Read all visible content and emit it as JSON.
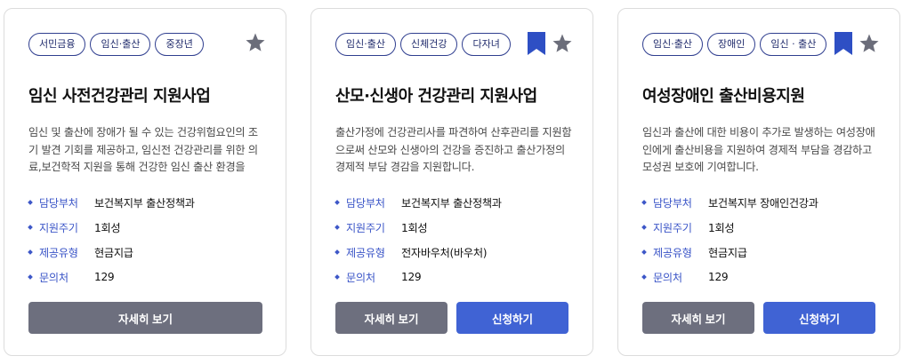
{
  "cards": [
    {
      "tags": [
        "서민금융",
        "임신·출산",
        "중장년"
      ],
      "bookmarked": false,
      "title": "임신 사전건강관리 지원사업",
      "description": "임신 및 출산에 장애가 될 수 있는 건강위험요인의 조기 발견 기회를 제공하고, 임신전 건강관리를 위한 의료,보건학적 지원을 통해 건강한 임신 출산 환경을",
      "info": [
        {
          "label": "담당부처",
          "value": "보건복지부 출산정책과"
        },
        {
          "label": "지원주기",
          "value": "1회성"
        },
        {
          "label": "제공유형",
          "value": "현금지급"
        },
        {
          "label": "문의처",
          "value": "129"
        }
      ],
      "detail_label": "자세히 보기",
      "apply_label": null
    },
    {
      "tags": [
        "임신·출산",
        "신체건강",
        "다자녀"
      ],
      "bookmarked": true,
      "title": "산모·신생아 건강관리 지원사업",
      "description": "출산가정에 건강관리사를 파견하여 산후관리를 지원함으로써 산모와 신생아의 건강을 증진하고 출산가정의 경제적 부담 경감을 지원합니다.",
      "info": [
        {
          "label": "담당부처",
          "value": "보건복지부 출산정책과"
        },
        {
          "label": "지원주기",
          "value": "1회성"
        },
        {
          "label": "제공유형",
          "value": "전자바우처(바우처)"
        },
        {
          "label": "문의처",
          "value": "129"
        }
      ],
      "detail_label": "자세히 보기",
      "apply_label": "신청하기"
    },
    {
      "tags": [
        "임신·출산",
        "장애인",
        "임신 · 출산"
      ],
      "bookmarked": true,
      "title": "여성장애인 출산비용지원",
      "description": "임신과 출산에 대한 비용이 추가로 발생하는 여성장애인에게 출산비용을 지원하여 경제적 부담을 경감하고 모성권 보호에 기여합니다.",
      "info": [
        {
          "label": "담당부처",
          "value": "보건복지부 장애인건강과"
        },
        {
          "label": "지원주기",
          "value": "1회성"
        },
        {
          "label": "제공유형",
          "value": "현금지급"
        },
        {
          "label": "문의처",
          "value": "129"
        }
      ],
      "detail_label": "자세히 보기",
      "apply_label": "신청하기"
    }
  ],
  "colors": {
    "accent": "#3d57c8",
    "tag_border": "#2f3e8f",
    "bookmark": "#2e4fc4",
    "star": "#6b6d7a",
    "detail_button": "#6d6f7e",
    "apply_button": "#4063d4"
  },
  "icons": {
    "bookmark": "bookmark-icon",
    "star": "star-icon",
    "bullet": "diamond-bullet-icon"
  }
}
